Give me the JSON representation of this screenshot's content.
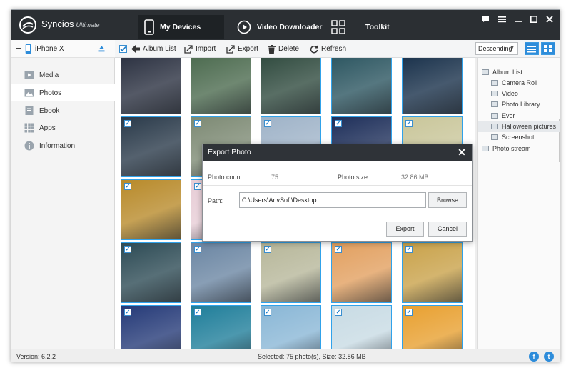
{
  "app": {
    "name": "Syncios",
    "edition": "Ultimate"
  },
  "nav": {
    "tabs": [
      {
        "label": "My Devices",
        "icon": "phone-icon",
        "active": true
      },
      {
        "label": "Video Downloader",
        "icon": "play-circle-icon",
        "active": false
      },
      {
        "label": "Toolkit",
        "icon": "grid-icon",
        "active": false
      }
    ]
  },
  "window_controls": [
    "chat-icon",
    "menu-icon",
    "minimize-icon",
    "maximize-icon",
    "close-icon"
  ],
  "device": {
    "name": "iPhone X"
  },
  "sidebar": {
    "items": [
      {
        "label": "Media",
        "icon": "media-icon",
        "active": false
      },
      {
        "label": "Photos",
        "icon": "photos-icon",
        "active": true
      },
      {
        "label": "Ebook",
        "icon": "book-icon",
        "active": false
      },
      {
        "label": "Apps",
        "icon": "apps-icon",
        "active": false
      },
      {
        "label": "Information",
        "icon": "info-icon",
        "active": false
      }
    ]
  },
  "toolbar": {
    "album_list": "Album List",
    "import": "Import",
    "export": "Export",
    "delete": "Delete",
    "refresh": "Refresh",
    "sort": "Descending"
  },
  "albums": {
    "items": [
      {
        "label": "Album List",
        "level": 0
      },
      {
        "label": "Camera Roll",
        "level": 1
      },
      {
        "label": "Video",
        "level": 1
      },
      {
        "label": "Photo Library",
        "level": 1
      },
      {
        "label": "Ever",
        "level": 1
      },
      {
        "label": "Halloween pictures",
        "level": 1,
        "highlighted": true
      },
      {
        "label": "Screenshot",
        "level": 1
      },
      {
        "label": "Photo stream",
        "level": 0
      }
    ]
  },
  "dialog": {
    "title": "Export Photo",
    "count_label": "Photo count:",
    "count_value": "75",
    "size_label": "Photo size:",
    "size_value": "32.86 MB",
    "path_label": "Path:",
    "path_value": "C:\\Users\\AnvSoft\\Desktop",
    "browse": "Browse",
    "export": "Export",
    "cancel": "Cancel"
  },
  "status": {
    "version": "Version: 6.2.2",
    "selection": "Selected: 75 photo(s), Size: 32.86 MB"
  },
  "social": {
    "facebook": "f",
    "twitter": "t"
  },
  "colors": {
    "accent": "#2d8cda",
    "titlebar": "#2b2f33",
    "selection_border": "#30a2ea"
  },
  "photos": {
    "rows": [
      [
        "#2a3040",
        "#4b6a4e",
        "#2f4a3e",
        "#2b5560",
        "#18304a"
      ],
      [
        "#2a3a4a",
        "#7d8a74",
        "#9fb3c8",
        "#1e2f5a",
        "#c9c69a"
      ],
      [
        "#b88a2a",
        "#e7cdd6",
        "#c07e7e",
        "#f1b3c2",
        "#8fb0b9"
      ],
      [
        "#2d4b55",
        "#6b86a3",
        "#b7b79a",
        "#e2a060",
        "#c9a24a"
      ],
      [
        "#253a78",
        "#1f7e9a",
        "#8ab7d6",
        "#c8dbe4",
        "#e8a030"
      ]
    ],
    "checked": true
  }
}
